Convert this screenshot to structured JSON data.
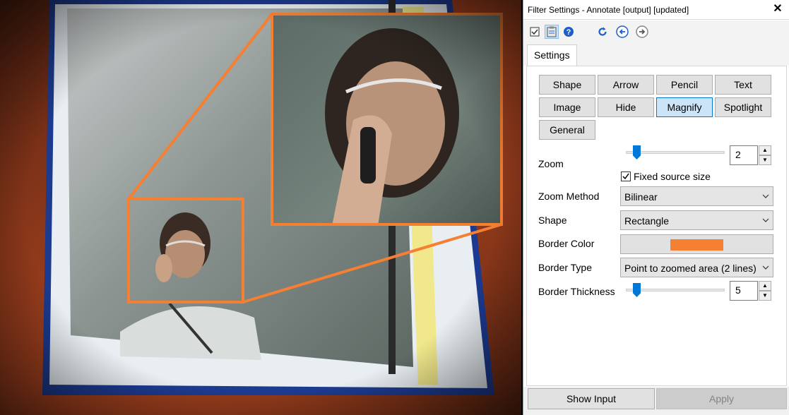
{
  "window": {
    "title": "Filter Settings - Annotate [output] [updated]",
    "close_glyph": "✕"
  },
  "toolbar": {
    "icons": [
      "checkbox-icon",
      "clipboard-icon",
      "help-icon",
      "refresh-icon",
      "back-arrow-icon",
      "forward-arrow-icon"
    ]
  },
  "tabs": [
    {
      "label": "Settings"
    }
  ],
  "filters": [
    {
      "label": "Shape"
    },
    {
      "label": "Arrow"
    },
    {
      "label": "Pencil"
    },
    {
      "label": "Text"
    },
    {
      "label": "Image"
    },
    {
      "label": "Hide"
    },
    {
      "label": "Magnify"
    },
    {
      "label": "Spotlight"
    },
    {
      "label": "General"
    }
  ],
  "active_filter": "Magnify",
  "zoom": {
    "label": "Zoom",
    "value": "2",
    "slider_fraction": 0.08,
    "fixed_source_label": "Fixed source size",
    "fixed_source_checked": true
  },
  "zoom_method": {
    "label": "Zoom Method",
    "value": "Bilinear"
  },
  "shape": {
    "label": "Shape",
    "value": "Rectangle"
  },
  "border_color": {
    "label": "Border Color",
    "color": "#F57F33"
  },
  "border_type": {
    "label": "Border Type",
    "value": "Point to zoomed area (2 lines)"
  },
  "border_thickness": {
    "label": "Border Thickness",
    "value": "5",
    "slider_fraction": 0.08
  },
  "footer": {
    "show_input_label": "Show Input",
    "apply_label": "Apply"
  },
  "colors": {
    "accent": "#0078D7",
    "annotation_orange": "#F57F33"
  }
}
